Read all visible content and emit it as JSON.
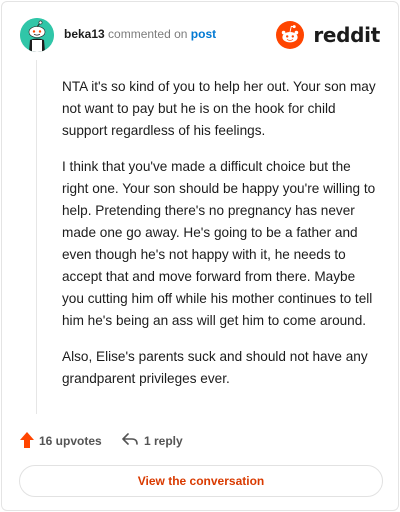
{
  "comment": {
    "username": "beka13",
    "action_text": "commented on",
    "post_link": "post",
    "paragraphs": [
      "NTA it's so kind of you to help her out. Your son may not want to pay but he is on the hook for child support regardless of his feelings.",
      "I think that you've made a difficult choice but the right one. Your son should be happy you're willing to help. Pretending there's no pregnancy has never made one go away. He's going to be a father and even though he's not happy with it, he needs to accept that and move forward from there. Maybe you cutting him off while his mother continues to tell him he's being an ass will get him to come around.",
      "Also, Elise's parents suck and should not have any grandparent privileges ever."
    ]
  },
  "brand": {
    "name": "reddit",
    "color": "#ff4500"
  },
  "avatar": {
    "icon": "snoo-avatar-icon",
    "color": "#30c6a8"
  },
  "actions": {
    "upvotes_label": "16 upvotes",
    "upvote_icon": "upvote-arrow-icon",
    "upvote_color": "#ff4500",
    "replies_label": "1 reply",
    "reply_icon": "reply-arrow-icon"
  },
  "footer": {
    "button_label": "View the conversation",
    "button_color": "#d93a00"
  }
}
